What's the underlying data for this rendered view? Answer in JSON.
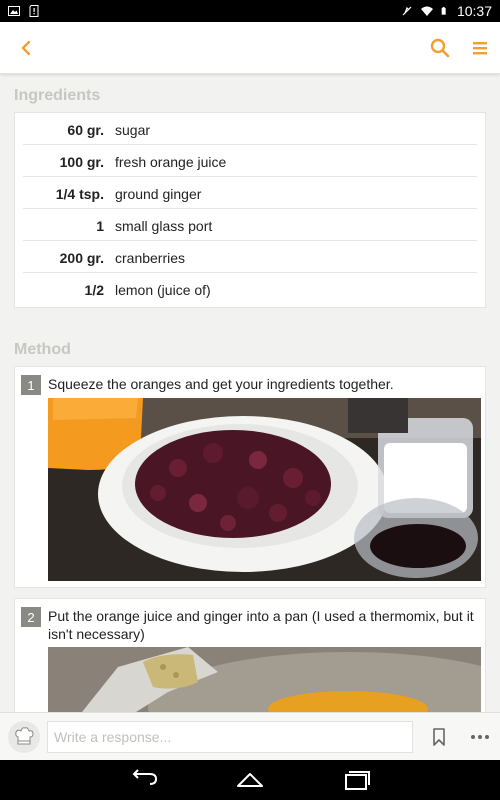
{
  "status_bar": {
    "time": "10:37",
    "icons": [
      "image-icon",
      "sd-card-icon",
      "mute-icon",
      "wifi-icon",
      "battery-icon"
    ]
  },
  "app_bar": {
    "icons": [
      "back-chevron-icon",
      "search-icon",
      "menu-icon"
    ],
    "accent_color": "#f0a030"
  },
  "ingredients": {
    "title": "Ingredients",
    "items": [
      {
        "qty": "60 gr.",
        "name": "sugar"
      },
      {
        "qty": "100 gr.",
        "name": "fresh orange juice"
      },
      {
        "qty": "1/4 tsp.",
        "name": "ground ginger"
      },
      {
        "qty": "1",
        "name": "small glass port"
      },
      {
        "qty": "200 gr.",
        "name": "cranberries"
      },
      {
        "qty": "1/2",
        "name": "lemon (juice of)"
      }
    ]
  },
  "method": {
    "title": "Method",
    "steps": [
      {
        "number": "1",
        "text": "Squeeze the oranges and get your ingredients together."
      },
      {
        "number": "2",
        "text": "Put the orange juice and ginger into a pan (I used a thermomix, but it isn't necessary)"
      }
    ]
  },
  "response_bar": {
    "placeholder": "Write a response..."
  },
  "nav_bar": {
    "icons": [
      "back-icon",
      "home-icon",
      "recents-icon"
    ]
  }
}
